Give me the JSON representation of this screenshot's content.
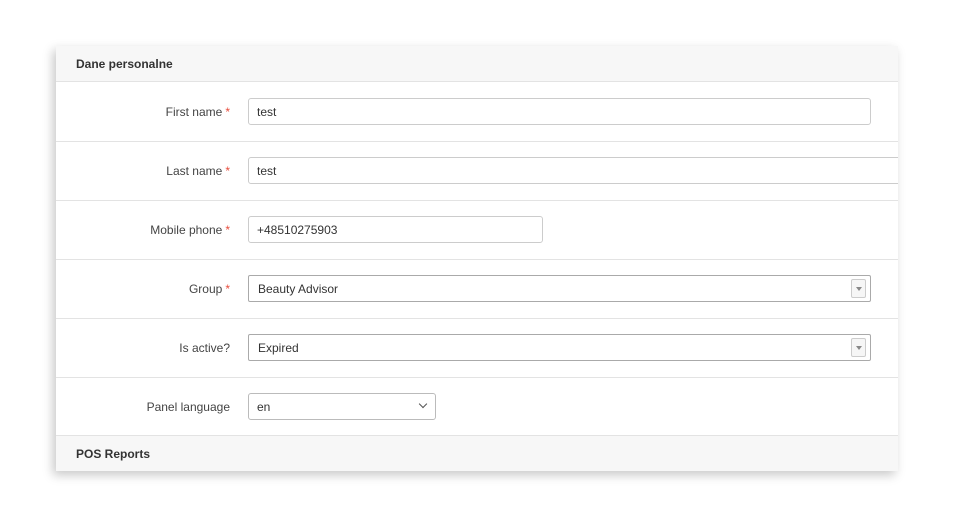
{
  "sections": {
    "personal": {
      "title": "Dane personalne"
    },
    "pos_reports": {
      "title": "POS Reports"
    }
  },
  "required_marker": "*",
  "fields": {
    "first_name": {
      "label": "First name",
      "value": "test"
    },
    "last_name": {
      "label": "Last name",
      "value": "test"
    },
    "mobile_phone": {
      "label": "Mobile phone",
      "value": "+48510275903"
    },
    "group": {
      "label": "Group",
      "value": "Beauty Advisor"
    },
    "is_active": {
      "label": "Is active?",
      "value": "Expired"
    },
    "panel_language": {
      "label": "Panel language",
      "value": "en"
    }
  }
}
